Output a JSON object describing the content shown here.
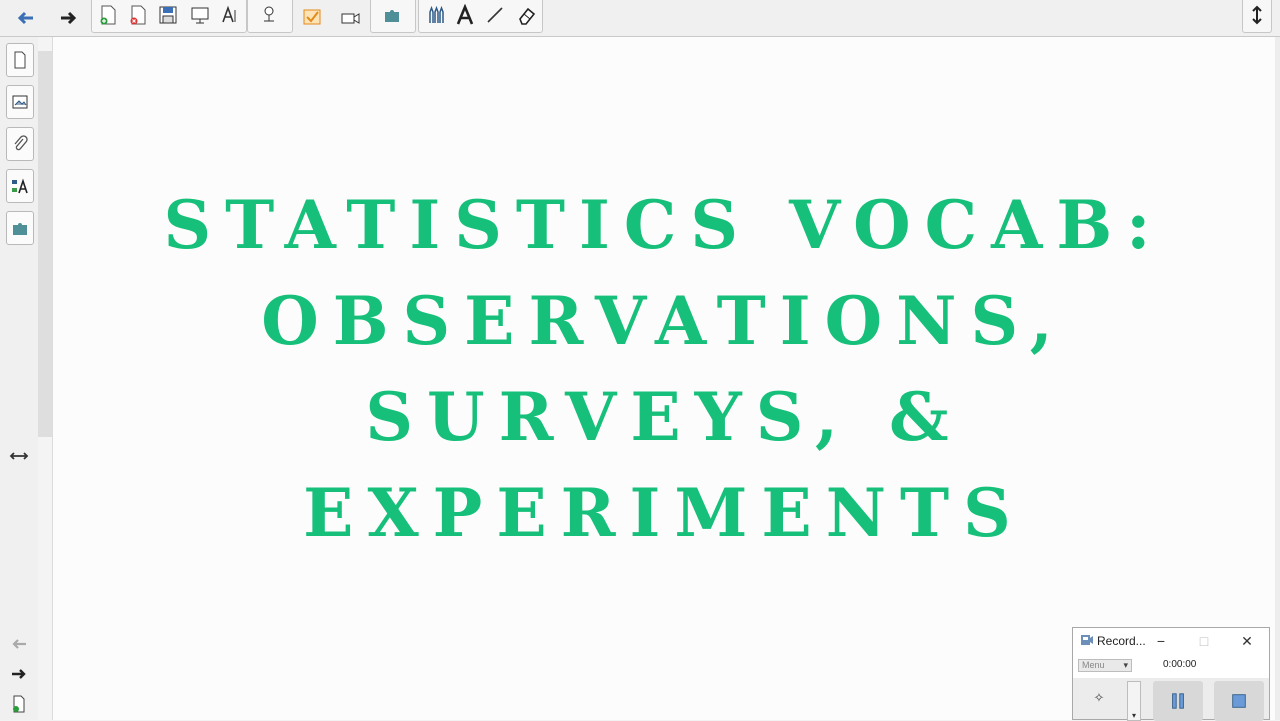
{
  "slide": {
    "title_lines": [
      "Statistics Vocab:",
      "Observations,",
      "Surveys, &",
      "Experiments"
    ],
    "title_color": "#17c07a"
  },
  "toolbar": {
    "icons": [
      "back-arrow-icon",
      "forward-arrow-icon",
      "new-page-icon",
      "delete-page-icon",
      "save-icon",
      "screen-shade-icon",
      "text-tool-icon",
      "document-camera-icon",
      "response-icon",
      "video-icon",
      "addons-icon",
      "pens-icon",
      "text-icon",
      "line-icon",
      "eraser-icon",
      "toolbar-toggle-icon"
    ]
  },
  "sidebar": {
    "tabs": [
      "page-sorter",
      "gallery",
      "attachments",
      "properties",
      "addons"
    ],
    "resize_icon": "resize-arrows-icon"
  },
  "recorder": {
    "title": "Record...",
    "minimize": "−",
    "maximize": "□",
    "close": "✕",
    "menu_label": "Menu",
    "time": "0:00:00"
  }
}
